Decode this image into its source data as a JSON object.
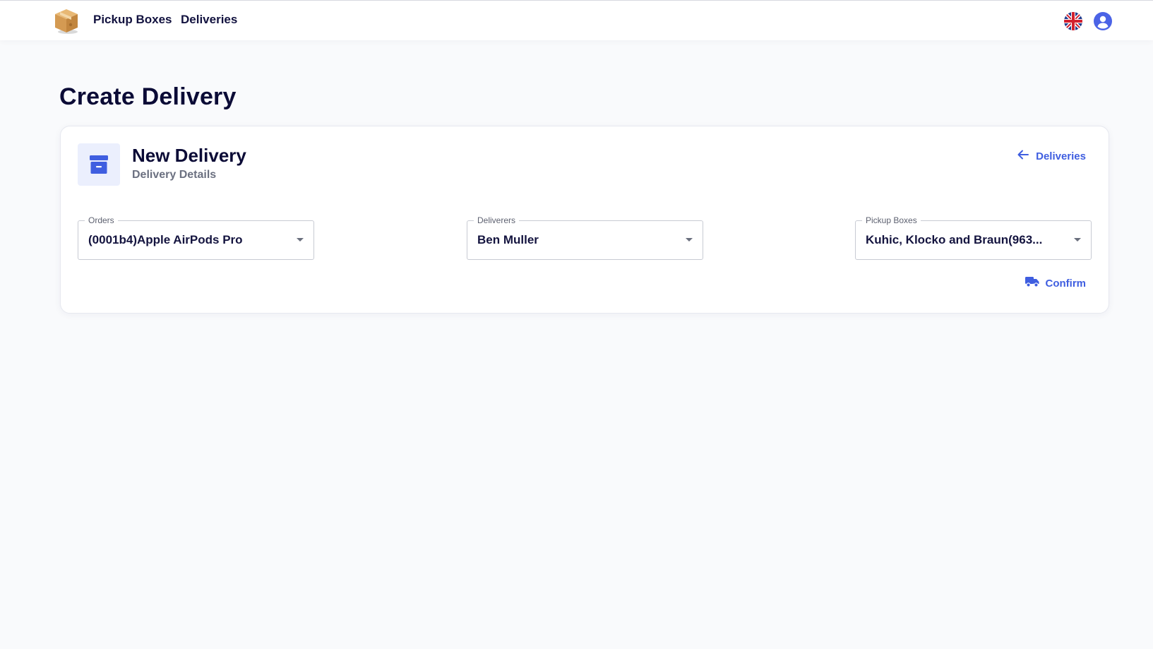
{
  "nav": {
    "logo_icon": "package-box-icon",
    "links": [
      {
        "label": "Pickup Boxes"
      },
      {
        "label": "Deliveries"
      }
    ],
    "language_icon": "uk-flag-icon",
    "account_icon": "user-circle-icon"
  },
  "page": {
    "title": "Create Delivery"
  },
  "card": {
    "icon": "archive-box-icon",
    "title": "New Delivery",
    "subtitle": "Delivery Details",
    "back_label": "Deliveries",
    "back_icon": "arrow-left-icon",
    "fields": {
      "orders": {
        "label": "Orders",
        "value": "(0001b4)Apple AirPods Pro"
      },
      "deliverers": {
        "label": "Deliverers",
        "value": "Ben Muller"
      },
      "pickup_boxes": {
        "label": "Pickup Boxes",
        "value": "Kuhic, Klocko and Braun(963..."
      }
    },
    "confirm_label": "Confirm",
    "confirm_icon": "truck-icon"
  },
  "colors": {
    "accent": "#3f5ee0",
    "background": "#f9fafc",
    "text_dark": "#0b0b36",
    "icon_tile": "#ebeffd"
  }
}
